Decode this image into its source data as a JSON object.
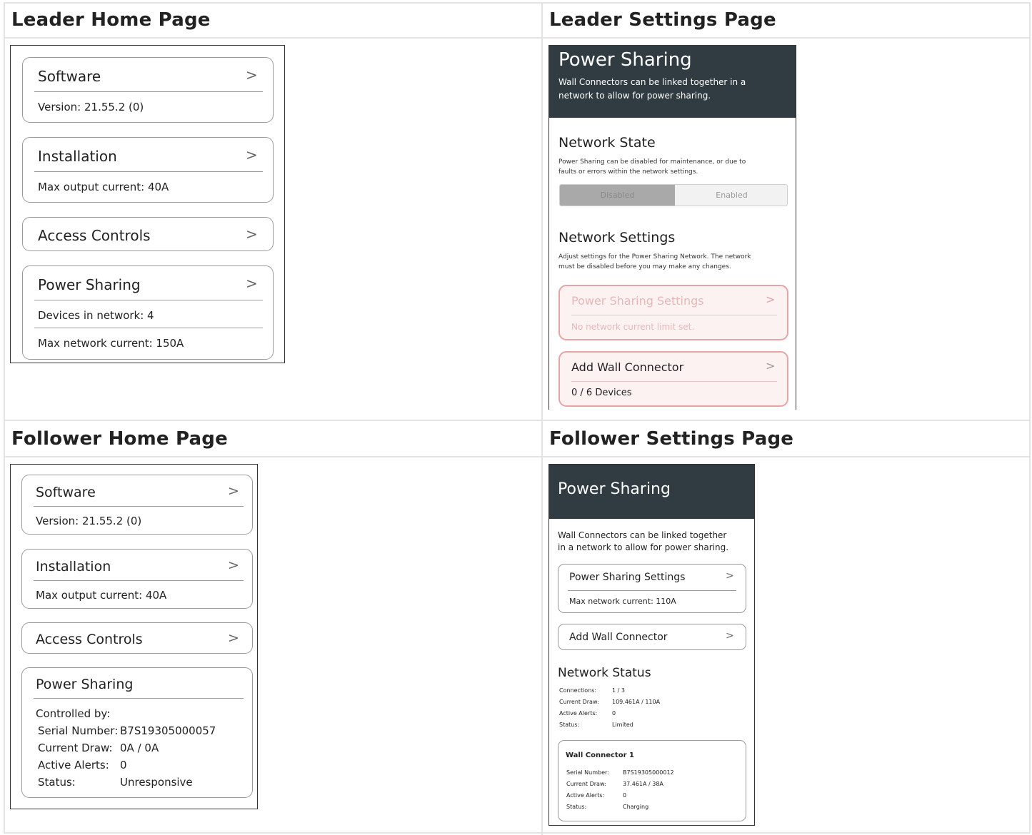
{
  "cells": {
    "leader_home_title": "Leader Home Page",
    "leader_settings_title": "Leader Settings Page",
    "follower_home_title": "Follower Home Page",
    "follower_settings_title": "Follower Settings Page"
  },
  "leader_home": {
    "software": {
      "title": "Software",
      "version": "Version: 21.55.2 (0)"
    },
    "installation": {
      "title": "Installation",
      "max_output": "Max output current: 40A"
    },
    "access_controls": {
      "title": "Access Controls"
    },
    "power_sharing": {
      "title": "Power Sharing",
      "devices": "Devices in network: 4",
      "max_network": "Max network current: 150A"
    },
    "chevron": ">"
  },
  "leader_settings": {
    "header_title": "Power Sharing",
    "header_sub_1": "Wall Connectors can be linked together in a",
    "header_sub_2": "network to allow for power sharing.",
    "network_state": {
      "title": "Network State",
      "desc_1": "Power Sharing can be disabled for maintenance, or due to",
      "desc_2": "faults or errors within the network settings.",
      "disabled": "Disabled",
      "enabled": "Enabled"
    },
    "network_settings": {
      "title": "Network Settings",
      "desc_1": "Adjust settings for the Power Sharing Network. The network",
      "desc_2": "must be disabled before you may make any changes.",
      "ps_settings_title": "Power Sharing Settings",
      "ps_settings_sub": "No network current limit set.",
      "add_wc_title": "Add Wall Connector",
      "add_wc_sub": "0 / 6 Devices"
    },
    "chevron": ">",
    "colors": {
      "header_bg": "#303c42",
      "warning_border": "#e6a4a4"
    }
  },
  "follower_home": {
    "software": {
      "title": "Software",
      "version": "Version: 21.55.2 (0)"
    },
    "installation": {
      "title": "Installation",
      "max_output": "Max output current: 40A"
    },
    "access_controls": {
      "title": "Access Controls"
    },
    "power_sharing": {
      "title": "Power Sharing",
      "controlled_by": "Controlled by:",
      "serial_label": "Serial Number:",
      "serial_value": "B7S19305000057",
      "draw_label": "Current Draw:",
      "draw_value": "0A / 0A",
      "alerts_label": "Active Alerts:",
      "alerts_value": "0",
      "status_label": "Status:",
      "status_value": "Unresponsive"
    },
    "chevron": ">"
  },
  "follower_settings": {
    "header_title": "Power Sharing",
    "intro_1": "Wall Connectors can be linked together",
    "intro_2": "in a network to allow for power sharing.",
    "ps_settings_title": "Power Sharing Settings",
    "ps_settings_sub": "Max network current: 110A",
    "add_wc_title": "Add Wall Connector",
    "network_status": {
      "title": "Network Status",
      "connections_label": "Connections:",
      "connections_value": "1 / 3",
      "draw_label": "Current Draw:",
      "draw_value": "109.461A / 110A",
      "alerts_label": "Active Alerts:",
      "alerts_value": "0",
      "status_label": "Status:",
      "status_value": "Limited"
    },
    "wall_connector": {
      "title": "Wall Connector 1",
      "serial_label": "Serial Number:",
      "serial_value": "B7S19305000012",
      "draw_label": "Current Draw:",
      "draw_value": "37.461A / 38A",
      "alerts_label": "Active Alerts:",
      "alerts_value": "0",
      "status_label": "Status:",
      "status_value": "Charging"
    },
    "chevron": ">"
  }
}
